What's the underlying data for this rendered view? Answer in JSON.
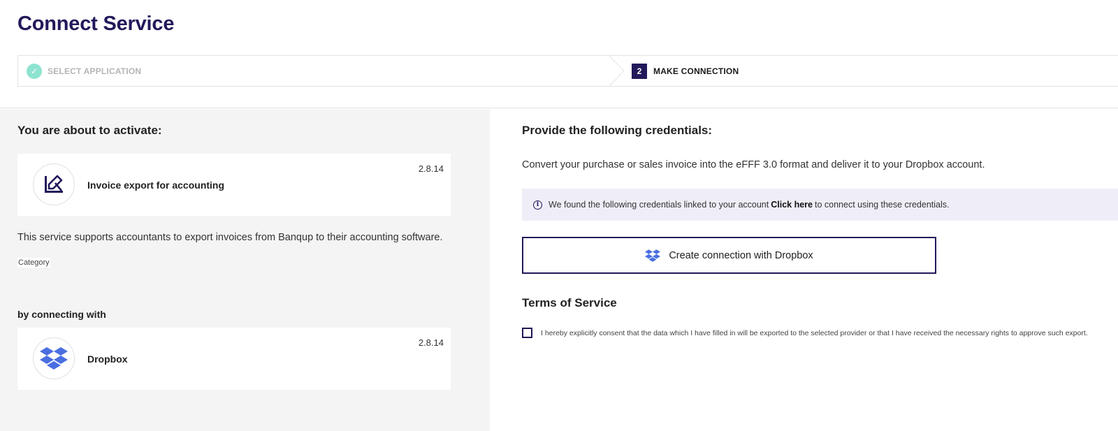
{
  "page": {
    "title": "Connect Service"
  },
  "stepper": {
    "steps": [
      {
        "label": "SELECT APPLICATION",
        "state": "completed",
        "icon": "check-icon"
      },
      {
        "number": "2",
        "label": "MAKE CONNECTION",
        "state": "active"
      }
    ]
  },
  "left": {
    "heading": "You are about to activate:",
    "service": {
      "name": "Invoice export for accounting",
      "version": "2.8.14",
      "icon": "invoice-export-logo-icon"
    },
    "description": "This service supports accountants to export invoices from Banqup to their accounting software.",
    "category_label": "Category",
    "connecting_heading": "by connecting with",
    "provider": {
      "name": "Dropbox",
      "version": "2.8.14",
      "icon": "dropbox-logo-icon"
    }
  },
  "right": {
    "heading": "Provide the following credentials:",
    "intro": "Convert your purchase or sales invoice into the eFFF 3.0 format and deliver it to your Dropbox account.",
    "info": {
      "text_before": "We found the following credentials linked to your account",
      "link": "Click here",
      "text_after": "to connect using these credentials."
    },
    "connect_button": "Create connection with Dropbox",
    "terms_heading": "Terms of Service",
    "consent_text": "I hereby explicitly consent that the data which I have filled in will be exported to the selected provider or that I have received the necessary rights to approve such export.",
    "consent_checked": false
  },
  "colors": {
    "brand": "#21195a",
    "dropbox": "#4a6fe0",
    "success": "#8ee3d0",
    "panel_bg": "#f4f4f4",
    "info_bg": "#efeef8"
  }
}
